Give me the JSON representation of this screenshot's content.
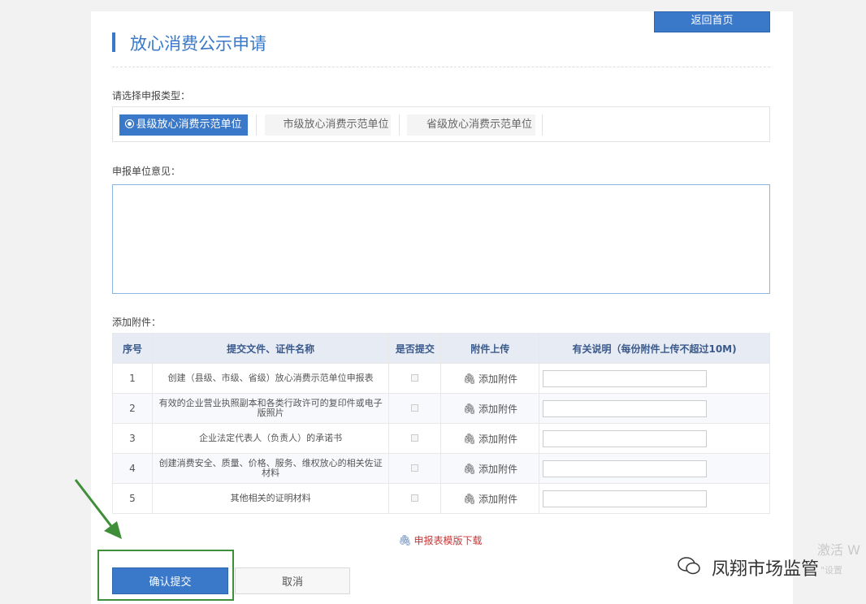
{
  "header": {
    "back_label": "返回首页",
    "title": "放心消费公示申请"
  },
  "type_section": {
    "label": "请选择申报类型：",
    "options": [
      {
        "label": "县级放心消费示范单位",
        "selected": true
      },
      {
        "label": "市级放心消费示范单位",
        "selected": false
      },
      {
        "label": "省级放心消费示范单位",
        "selected": false
      }
    ]
  },
  "opinion_section": {
    "label": "申报单位意见：",
    "value": ""
  },
  "attachments": {
    "label": "添加附件：",
    "headers": [
      "序号",
      "提交文件、证件名称",
      "是否提交",
      "附件上传",
      "有关说明（每份附件上传不超过10M)"
    ],
    "rows": [
      {
        "no": "1",
        "name": "创建（县级、市级、省级）放心消费示范单位申报表",
        "upload": "添加附件"
      },
      {
        "no": "2",
        "name": "有效的企业营业执照副本和各类行政许可的复印件或电子版照片",
        "upload": "添加附件"
      },
      {
        "no": "3",
        "name": "企业法定代表人（负责人）的承诺书",
        "upload": "添加附件"
      },
      {
        "no": "4",
        "name": "创建消费安全、质量、价格、服务、维权放心的相关佐证材料",
        "upload": "添加附件"
      },
      {
        "no": "5",
        "name": "其他相关的证明材料",
        "upload": "添加附件"
      }
    ],
    "download_label": "申报表模版下载"
  },
  "actions": {
    "submit_label": "确认提交",
    "cancel_label": "取消"
  },
  "watermark": {
    "activate": "激活 W",
    "settings": "\"设置",
    "logo_text": "凤翔市场监管"
  },
  "colors": {
    "accent": "#3a78c9",
    "highlight": "#3f8f3a",
    "download": "#cc3333"
  }
}
